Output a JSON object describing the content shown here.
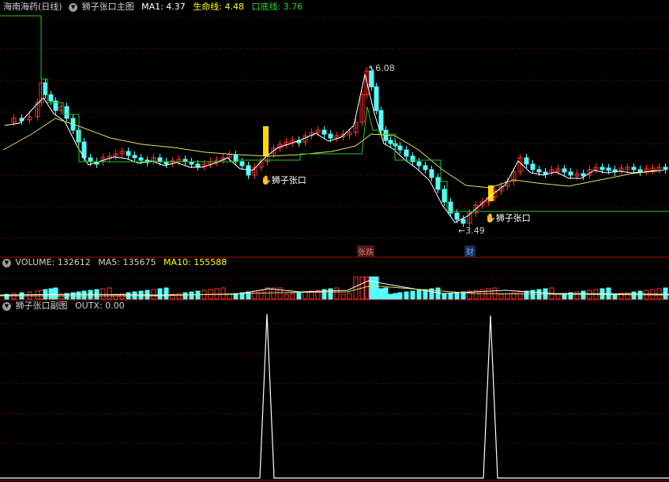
{
  "main_panel": {
    "stock_name": "海南海药(日线)",
    "indicator_title": "狮子张口主图",
    "ma1_label": "MA1: 4.37",
    "life_line_label": "生命线: 4.48",
    "bottom_line_label": "口底线: 3.76",
    "high_marker": "6.08",
    "low_marker": "3.49",
    "signal_label_1": "狮子张口",
    "signal_label_2": "狮子张口",
    "event_tag_1": "张跌",
    "event_tag_2": "财"
  },
  "volume_panel": {
    "volume_label": "VOLUME: 132612",
    "ma5_label": "MA5: 135675",
    "ma10_label": "MA10: 155588"
  },
  "sub_panel": {
    "title": "狮子张口副图",
    "outx_label": "OUTX: 0.00"
  },
  "colors": {
    "up": "#ff3232",
    "down": "#54fcfc",
    "ma1": "#ffffff",
    "life_line": "#e0e060",
    "bottom_line": "#22c822",
    "signal_bar": "#ffd700",
    "grid": "#8b0000"
  },
  "chart_data": {
    "type": "candlestick",
    "price_high": 6.08,
    "price_low": 3.49,
    "volume": 132612,
    "ma5_volume": 135675,
    "ma10_volume": 155588,
    "ma1": 4.37,
    "life_line": 4.48,
    "bottom_line": 3.76,
    "outx": 0.0,
    "outx_signals": 2
  }
}
